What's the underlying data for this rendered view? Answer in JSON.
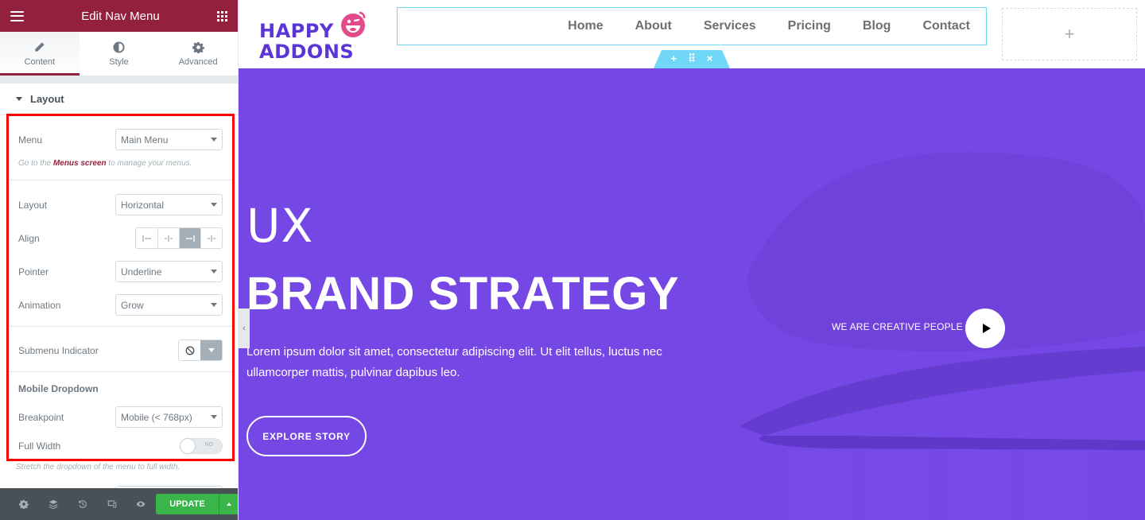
{
  "panel": {
    "title": "Edit Nav Menu",
    "tabs": [
      {
        "label": "Content",
        "icon": "pencil-icon",
        "active": true
      },
      {
        "label": "Style",
        "icon": "contrast-icon",
        "active": false
      },
      {
        "label": "Advanced",
        "icon": "gear-icon",
        "active": false
      }
    ],
    "section_title": "Layout",
    "menu": {
      "label": "Menu",
      "value": "Main Menu"
    },
    "menu_help": {
      "prefix": "Go to the ",
      "link": "Menus screen",
      "suffix": " to manage your menus."
    },
    "layout": {
      "label": "Layout",
      "value": "Horizontal"
    },
    "align": {
      "label": "Align",
      "options": [
        "left",
        "center",
        "right",
        "justify"
      ],
      "selected": "right"
    },
    "pointer": {
      "label": "Pointer",
      "value": "Underline"
    },
    "animation": {
      "label": "Animation",
      "value": "Grow"
    },
    "submenu_indicator": {
      "label": "Submenu Indicator",
      "value": "none"
    },
    "mobile_heading": "Mobile Dropdown",
    "breakpoint": {
      "label": "Breakpoint",
      "value": "Mobile (< 768px)"
    },
    "full_width": {
      "label": "Full Width",
      "state": "NO"
    },
    "full_width_help": "Stretch the dropdown of the menu to full width.",
    "footer": {
      "icons": [
        "settings-icon",
        "layers-icon",
        "history-icon",
        "responsive-icon",
        "preview-icon"
      ],
      "update_label": "UPDATE"
    },
    "colors": {
      "header": "#93213e",
      "update": "#39b54a",
      "highlight_border": "#ff0000"
    }
  },
  "site": {
    "logo": {
      "line1": "HAPPY",
      "line2": "ADDONS"
    },
    "nav": [
      "Home",
      "About",
      "Services",
      "Pricing",
      "Blog",
      "Contact"
    ],
    "handle": {
      "add": "+",
      "move": "⠿",
      "close": "×"
    },
    "empty_column": "+",
    "hero": {
      "kicker": "UX",
      "title": "BRAND STRATEGY",
      "text": "Lorem ipsum dolor sit amet, consectetur adipiscing elit. Ut elit tellus, luctus nec ullamcorper mattis, pulvinar dapibus leo.",
      "button": "EXPLORE STORY",
      "tagline": "WE ARE CREATIVE PEOPLE"
    },
    "colors": {
      "hero_bg": "#7547e4",
      "nav_border": "#71d7f7",
      "logo": "#5a35d8",
      "logo_face": "#e34a8a"
    }
  }
}
